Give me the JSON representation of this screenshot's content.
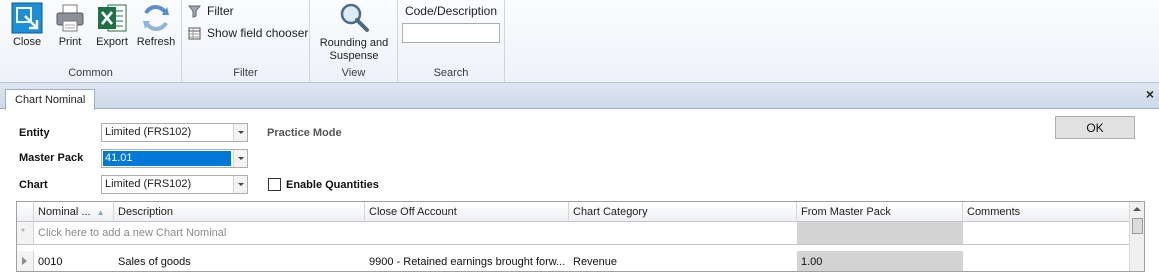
{
  "ribbon": {
    "common": {
      "label": "Common",
      "close": "Close",
      "print": "Print",
      "export": "Export",
      "refresh": "Refresh"
    },
    "filter": {
      "label": "Filter",
      "filter_item": "Filter",
      "field_chooser": "Show field chooser"
    },
    "view": {
      "label": "View",
      "rounding_line1": "Rounding and",
      "rounding_line2": "Suspense"
    },
    "search": {
      "label": "Search",
      "field_label": "Code/Description",
      "value": ""
    }
  },
  "tabs": [
    {
      "label": "Chart Nominal",
      "active": true
    }
  ],
  "form": {
    "entity_label": "Entity",
    "entity_value": "Limited (FRS102)",
    "master_pack_label": "Master Pack",
    "master_pack_value": "41.01",
    "chart_label": "Chart",
    "chart_value": "Limited (FRS102)",
    "practice_mode": "Practice Mode",
    "enable_quantities_label": "Enable Quantities",
    "enable_quantities_checked": false,
    "ok_label": "OK"
  },
  "grid": {
    "columns": [
      "Nominal ...",
      "Description",
      "Close Off Account",
      "Chart Category",
      "From Master Pack",
      "Comments"
    ],
    "new_row_text": "Click here to add a new Chart Nominal",
    "rows": [
      {
        "nominal": "0010",
        "description": "Sales of goods",
        "close_off_account": "9900 - Retained earnings brought forw...",
        "chart_category": "Revenue",
        "from_master_pack": "1.00",
        "comments": ""
      }
    ]
  },
  "colors": {
    "accent": "#0078d7",
    "ribbon_bg": "#eef2f8",
    "excel_green": "#1e7145"
  }
}
